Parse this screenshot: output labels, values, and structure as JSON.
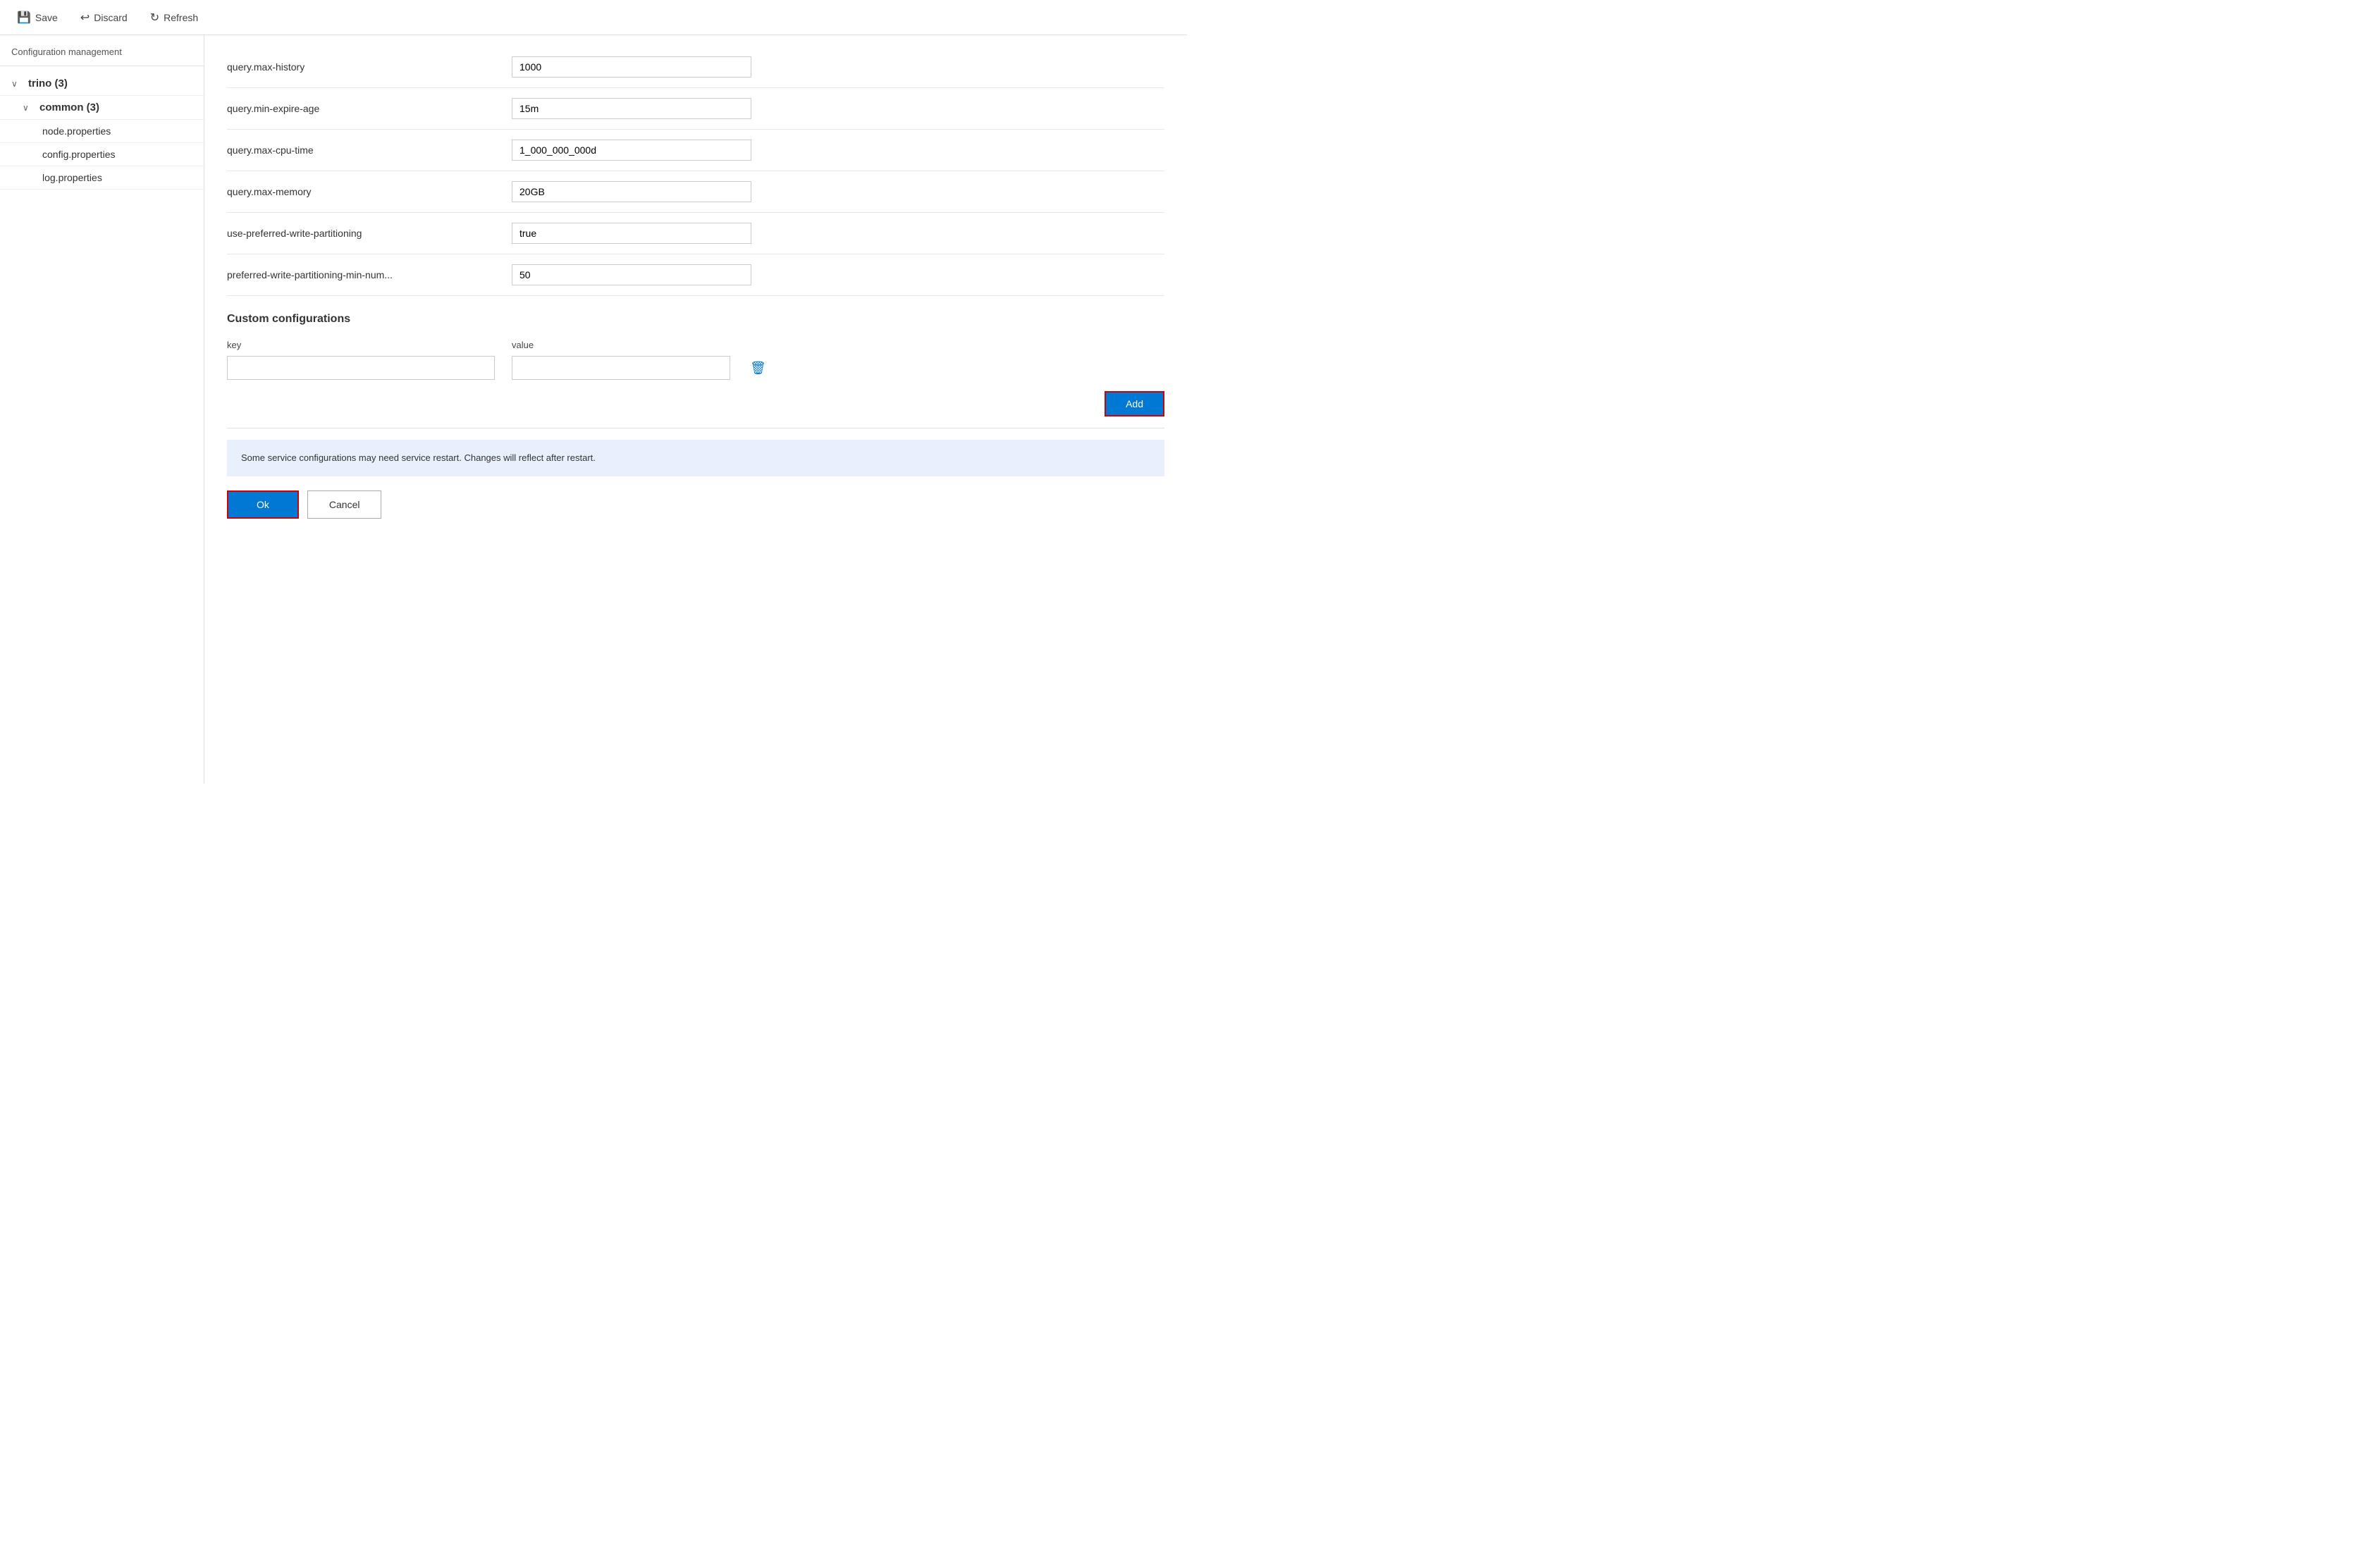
{
  "toolbar": {
    "save_label": "Save",
    "discard_label": "Discard",
    "refresh_label": "Refresh"
  },
  "left_panel": {
    "title": "Configuration management",
    "tree": {
      "root_label": "trino (3)",
      "root_count": "3",
      "sub_label": "common (3)",
      "sub_count": "3",
      "leaves": [
        "node.properties",
        "config.properties",
        "log.properties"
      ]
    }
  },
  "right_panel": {
    "configs": [
      {
        "key": "query.max-history",
        "value": "1000"
      },
      {
        "key": "query.min-expire-age",
        "value": "15m"
      },
      {
        "key": "query.max-cpu-time",
        "value": "1_000_000_000d"
      },
      {
        "key": "query.max-memory",
        "value": "20GB"
      },
      {
        "key": "use-preferred-write-partitioning",
        "value": "true"
      },
      {
        "key": "preferred-write-partitioning-min-num...",
        "value": "50"
      }
    ],
    "custom_section": {
      "title": "Custom configurations",
      "col_key": "key",
      "col_value": "value",
      "key_placeholder": "",
      "value_placeholder": "",
      "add_label": "Add"
    },
    "info_banner": "Some service configurations may need service restart. Changes will reflect after restart.",
    "ok_label": "Ok",
    "cancel_label": "Cancel"
  }
}
